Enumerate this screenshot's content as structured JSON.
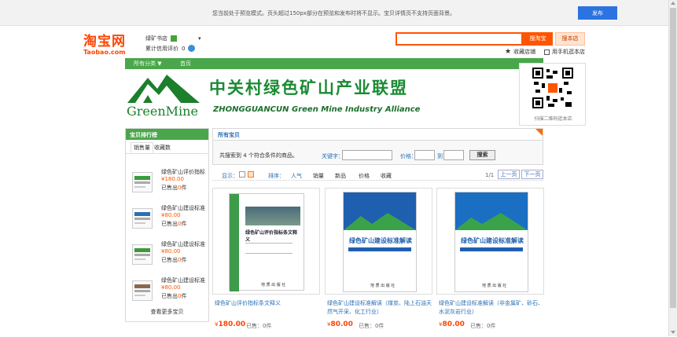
{
  "preview": {
    "message": "您当前处于预览模式。页头超过150px部分在预览和发布时将不显示。宝贝详情页不支持页面背景。",
    "publish_label": "发布"
  },
  "header": {
    "logo_cn": "淘宝网",
    "logo_en": "Taobao.com",
    "shop_name": "绿矿书店",
    "rating_label": "累计信用评价",
    "rating_value": "0",
    "search_taobao_label": "搜淘宝",
    "search_shop_label": "搜本店",
    "favorite_label": "收藏店铺",
    "mobile_label": "用手机逛本店"
  },
  "nav": {
    "items": [
      {
        "label": "所有分类 ▼"
      },
      {
        "label": "首页"
      }
    ]
  },
  "banner": {
    "logo_text": "GreenMine",
    "title_cn": "中关村绿色矿山产业联盟",
    "title_en": "ZHONGGUANCUN Green Mine Industry Alliance",
    "qr_caption": "扫描二维码逛本店"
  },
  "sidebar": {
    "title": "宝贝排行榜",
    "tabs": [
      "销售量",
      "收藏数"
    ],
    "items": [
      {
        "name": "绿色矿山评价指标",
        "price": "¥180.00",
        "sold_prefix": "已售出",
        "sold_count": "0",
        "sold_suffix": "件"
      },
      {
        "name": "绿色矿山建设标准",
        "price": "¥80.00",
        "sold_prefix": "已售出",
        "sold_count": "0",
        "sold_suffix": "件"
      },
      {
        "name": "绿色矿山建设标准",
        "price": "¥80.00",
        "sold_prefix": "已售出",
        "sold_count": "0",
        "sold_suffix": "件"
      },
      {
        "name": "绿色矿山建设标准",
        "price": "¥80.00",
        "sold_prefix": "已售出",
        "sold_count": "0",
        "sold_suffix": "件"
      }
    ],
    "more_label": "查看更多宝贝"
  },
  "main": {
    "title": "所有宝贝",
    "total_text": "共搜索到 4 个符合条件的商品。",
    "keyword_label": "关键字：",
    "price_label": "价格：",
    "to_label": "到",
    "search_label": "搜索",
    "display_label": "显示：",
    "sort_label": "排序：",
    "sort_items": [
      "人气",
      "销量",
      "新品",
      "价格",
      "收藏"
    ],
    "pager_text": "1/1",
    "prev_label": "上一页",
    "next_label": "下一页"
  },
  "products": [
    {
      "name": "绿色矿山评价指标条文释义",
      "price_symbol": "¥",
      "price": "180.00",
      "sold": "已售：0件",
      "cover_title": "绿色矿山评价指标条文释义",
      "publisher": "地 质 出 版 社"
    },
    {
      "name": "绿色矿山建设标准解读（煤炭、陆上石油天然气开采、化工行业）",
      "price_symbol": "¥",
      "price": "80.00",
      "sold": "已售：0件",
      "cover_title": "绿色矿山建设标准解读",
      "publisher": "地 质 出 版 社"
    },
    {
      "name": "绿色矿山建设标准解读（非金属矿、砂石、水泥灰岩行业）",
      "price_symbol": "¥",
      "price": "80.00",
      "sold": "已售：0件",
      "cover_title": "绿色矿山建设标准解读",
      "publisher": "地 质 出 版 社"
    }
  ],
  "colors": {
    "taobao_orange": "#ff4400",
    "nav_green": "#4aa64b",
    "link_blue": "#2a6fb5",
    "publish_blue": "#2b73e0"
  }
}
